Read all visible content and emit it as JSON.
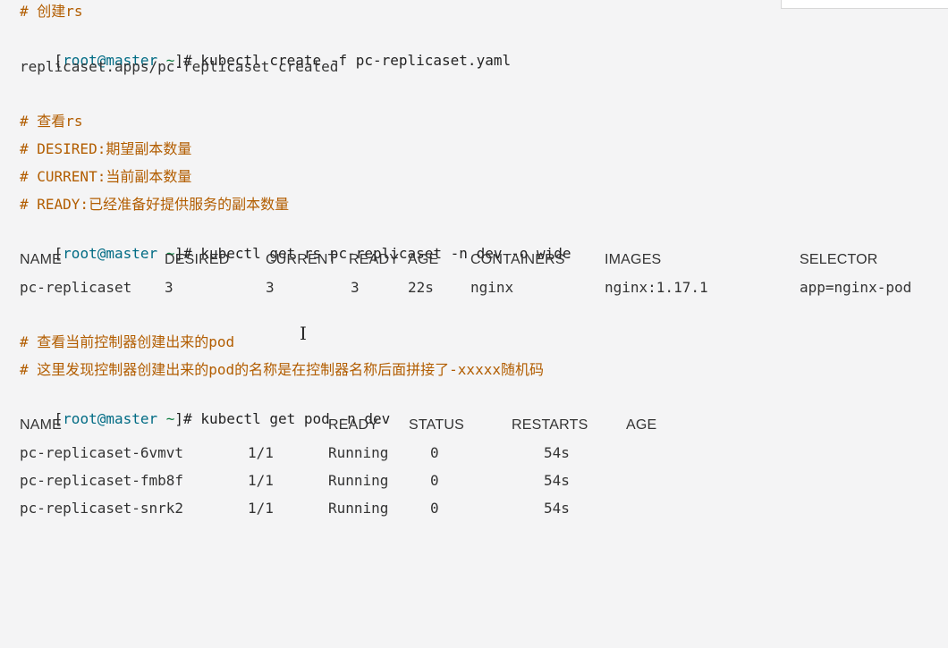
{
  "lines": {
    "c1": "# 创建rs",
    "p1": {
      "open": "[",
      "user": "root@master",
      "tilde": " ~",
      "close": "]# ",
      "cmd": "kubectl create -f pc-replicaset.yaml"
    },
    "o1": "replicaset.apps/pc-replicaset created",
    "c2": "# 查看rs",
    "c3": "# DESIRED:期望副本数量",
    "c4": "# CURRENT:当前副本数量",
    "c5": "# READY:已经准备好提供服务的副本数量",
    "p2": {
      "open": "[",
      "user": "root@master",
      "tilde": " ~",
      "close": "]# ",
      "cmd": "kubectl get rs pc-replicaset -n dev -o wide"
    },
    "c6": "# 查看当前控制器创建出来的pod",
    "c7": "# 这里发现控制器创建出来的pod的名称是在控制器名称后面拼接了-xxxxx随机码",
    "p3": {
      "open": "[",
      "user": "root@master",
      "tilde": " ~",
      "close": "]# ",
      "cmd": "kubectl get pod -n dev"
    }
  },
  "rs_table": {
    "headers": [
      "NAME",
      "DESIRED",
      "CURRENT",
      "READY",
      "AGE",
      "CONTAINERS",
      "IMAGES",
      "SELECTOR"
    ],
    "row": [
      "pc-replicaset",
      "3",
      "3",
      "3",
      "22s",
      "nginx",
      "nginx:1.17.1",
      "app=nginx-pod"
    ]
  },
  "pod_table": {
    "headers": [
      "NAME",
      "READY",
      "STATUS",
      "RESTARTS",
      "AGE"
    ],
    "rows": [
      [
        "pc-replicaset-6vmvt",
        "1/1",
        "Running",
        "0",
        "54s"
      ],
      [
        "pc-replicaset-fmb8f",
        "1/1",
        "Running",
        "0",
        "54s"
      ],
      [
        "pc-replicaset-snrk2",
        "1/1",
        "Running",
        "0",
        "54s"
      ]
    ]
  },
  "cursor": {
    "glyph": "I"
  }
}
